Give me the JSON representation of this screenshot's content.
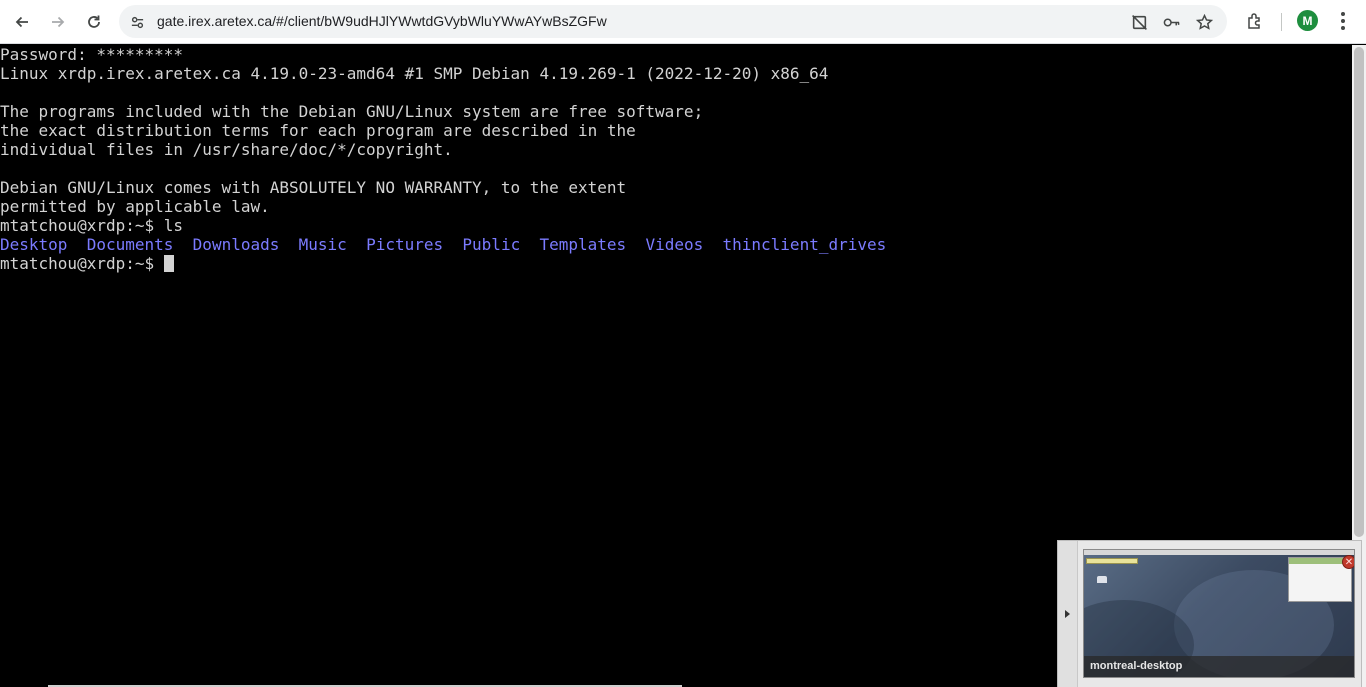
{
  "browser": {
    "url": "gate.irex.aretex.ca/#/client/bW9udHJlYWwtdGVybWluYWwAYwBsZGFw",
    "profile_initial": "M",
    "colors": {
      "avatar": "#1e8e3e",
      "omnibox": "#f1f3f4"
    },
    "icons": [
      "back-icon",
      "forward-icon",
      "reload-icon",
      "site-settings-icon",
      "cast-blocked-icon",
      "key-icon",
      "star-icon",
      "extensions-icon",
      "menu-icon"
    ]
  },
  "terminal": {
    "colors": {
      "text": "#d3d3d3",
      "directory": "#7b7bff",
      "background": "#000000"
    },
    "lines": [
      "Password: *********",
      "Linux xrdp.irex.aretex.ca 4.19.0-23-amd64 #1 SMP Debian 4.19.269-1 (2022-12-20) x86_64",
      "",
      "The programs included with the Debian GNU/Linux system are free software;",
      "the exact distribution terms for each program are described in the",
      "individual files in /usr/share/doc/*/copyright.",
      "",
      "Debian GNU/Linux comes with ABSOLUTELY NO WARRANTY, to the extent",
      "permitted by applicable law.",
      "mtatchou@xrdp:~$ ls"
    ],
    "ls_output": [
      "Desktop",
      "Documents",
      "Downloads",
      "Music",
      "Pictures",
      "Public",
      "Templates",
      "Videos",
      "thinclient_drives"
    ],
    "prompt": "mtatchou@xrdp:~$"
  },
  "connection_thumbnail": {
    "label": "montreal-desktop",
    "close_glyph": "✕"
  }
}
